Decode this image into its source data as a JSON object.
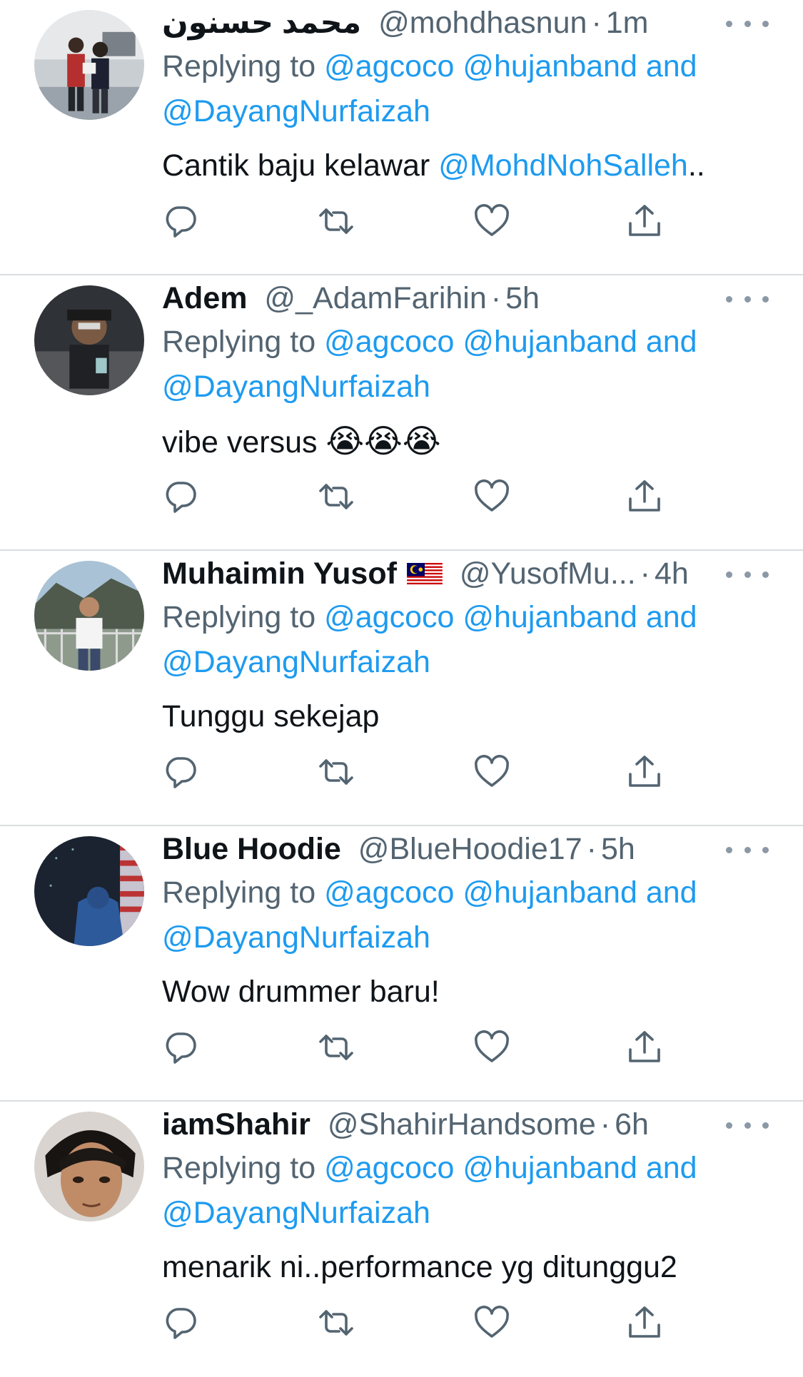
{
  "tweets": [
    {
      "name": "محمد حسنون",
      "name_rtl": true,
      "handle": "@mohdhasnun",
      "time": "1m",
      "reply_prefix": "Replying to",
      "mentions": [
        "@agcoco",
        "@hujanband"
      ],
      "reply_and": "and",
      "mention_last": "@DayangNurfaizah",
      "text": "Cantik baju kelawar",
      "text_mention": "@MohdNohSalleh",
      "text_suffix": ".."
    },
    {
      "name": "Adem",
      "handle": "@_AdamFarihin",
      "time": "5h",
      "reply_prefix": "Replying to",
      "mentions": [
        "@agcoco",
        "@hujanband"
      ],
      "reply_and": "and",
      "mention_last": "@DayangNurfaizah",
      "text": "vibe versus",
      "emoji": "😭😭😭"
    },
    {
      "name": "Muhaimin Yusof",
      "flag": "Malaysia flag",
      "handle": "@YusofMu...",
      "time": "4h",
      "reply_prefix": "Replying to",
      "mentions": [
        "@agcoco",
        "@hujanband"
      ],
      "reply_and": "and",
      "mention_last": "@DayangNurfaizah",
      "text": "Tunggu sekejap"
    },
    {
      "name": "Blue Hoodie",
      "handle": "@BlueHoodie17",
      "time": "5h",
      "reply_prefix": "Replying to",
      "mentions": [
        "@agcoco",
        "@hujanband"
      ],
      "reply_and": "and",
      "mention_last": "@DayangNurfaizah",
      "text": "Wow drummer baru!"
    },
    {
      "name": "iamShahir",
      "handle": "@ShahirHandsome",
      "time": "6h",
      "reply_prefix": "Replying to",
      "mentions": [
        "@agcoco",
        "@hujanband"
      ],
      "reply_and": "and",
      "mention_last": "@DayangNurfaizah",
      "text": "menarik ni..performance yg ditunggu2"
    }
  ],
  "separator": "·",
  "colors": {
    "link": "#1d9bf0",
    "secondary_text": "#536471",
    "primary_text": "#0f1419",
    "divider": "#d9dde0"
  },
  "icons": {
    "action_bar": [
      "reply-icon",
      "retweet-icon",
      "like-icon",
      "share-icon"
    ],
    "overflow": "more-options-icon"
  }
}
